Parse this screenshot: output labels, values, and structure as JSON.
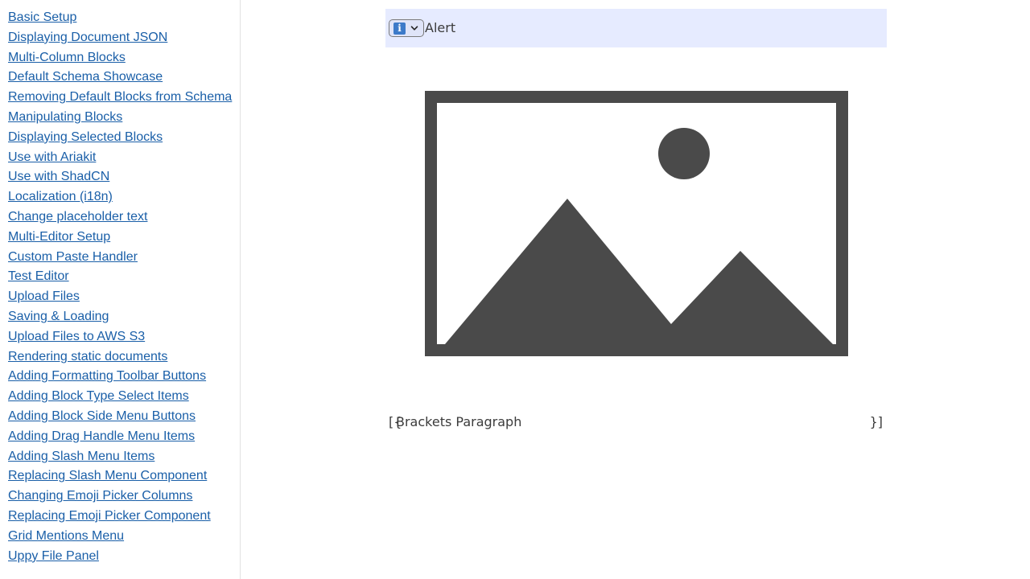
{
  "sidebar": {
    "items": [
      {
        "label": "Basic Setup"
      },
      {
        "label": "Displaying Document JSON"
      },
      {
        "label": "Multi-Column Blocks"
      },
      {
        "label": "Default Schema Showcase"
      },
      {
        "label": "Removing Default Blocks from Schema"
      },
      {
        "label": "Manipulating Blocks"
      },
      {
        "label": "Displaying Selected Blocks"
      },
      {
        "label": "Use with Ariakit"
      },
      {
        "label": "Use with ShadCN"
      },
      {
        "label": "Localization (i18n)"
      },
      {
        "label": "Change placeholder text"
      },
      {
        "label": "Multi-Editor Setup"
      },
      {
        "label": "Custom Paste Handler"
      },
      {
        "label": "Test Editor"
      },
      {
        "label": "Upload Files"
      },
      {
        "label": "Saving & Loading"
      },
      {
        "label": "Upload Files to AWS S3"
      },
      {
        "label": "Rendering static documents"
      },
      {
        "label": "Adding Formatting Toolbar Buttons"
      },
      {
        "label": "Adding Block Type Select Items"
      },
      {
        "label": "Adding Block Side Menu Buttons"
      },
      {
        "label": "Adding Drag Handle Menu Items"
      },
      {
        "label": "Adding Slash Menu Items"
      },
      {
        "label": "Replacing Slash Menu Component"
      },
      {
        "label": "Changing Emoji Picker Columns"
      },
      {
        "label": "Replacing Emoji Picker Component"
      },
      {
        "label": "Grid Mentions Menu"
      },
      {
        "label": "Uppy File Panel"
      }
    ]
  },
  "editor": {
    "alert": {
      "type_icon": "info-icon",
      "text": "Alert",
      "background": "#e6ebff",
      "icon_color": "#3c7ac9"
    },
    "image": {
      "icon": "image-placeholder-icon",
      "color": "#4a4a4a"
    },
    "brackets": {
      "open": "[{",
      "text": "Brackets Paragraph",
      "close": "}]"
    }
  },
  "colors": {
    "link": "#1a5fa8",
    "text": "#3b3b3b"
  }
}
